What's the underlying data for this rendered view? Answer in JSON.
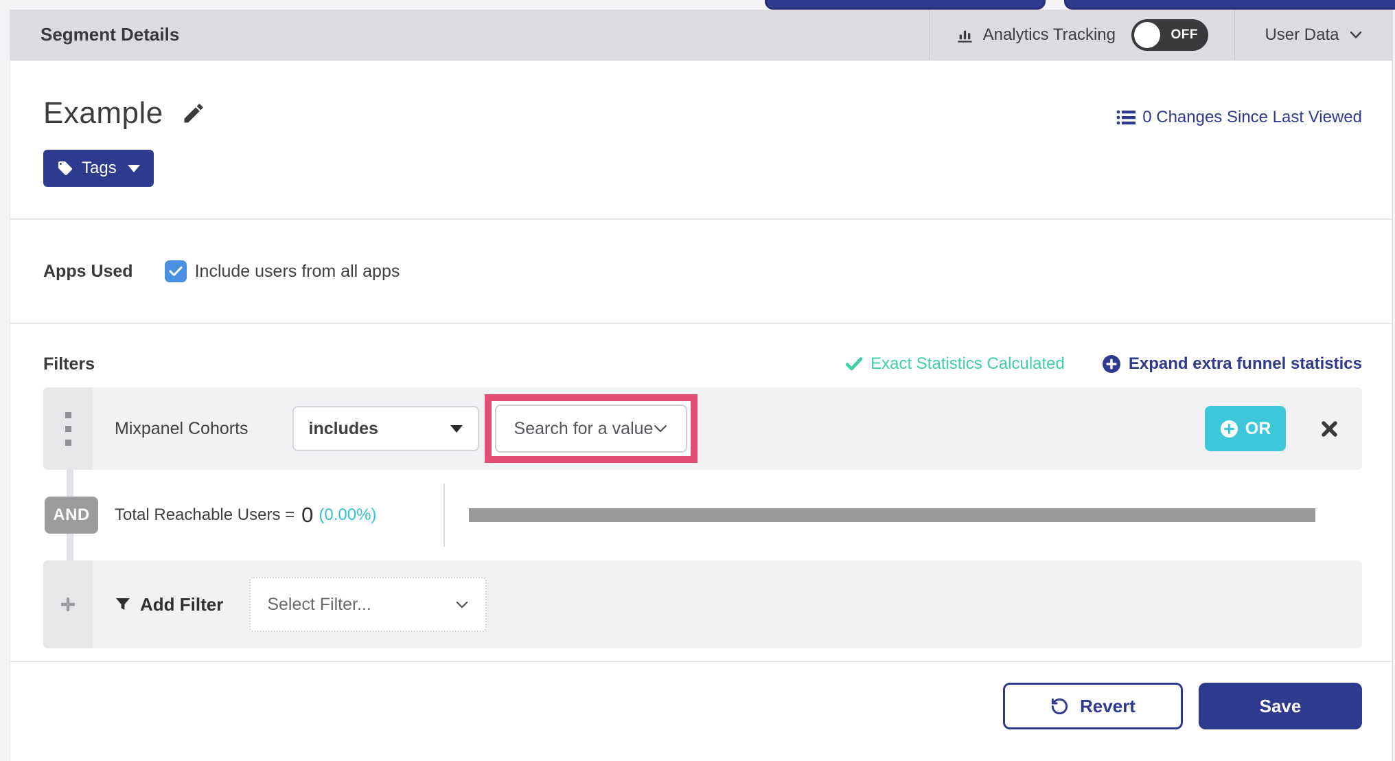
{
  "header": {
    "title": "Segment Details",
    "analytics_label": "Analytics Tracking",
    "toggle_state": "OFF",
    "user_data_label": "User Data"
  },
  "segment": {
    "name": "Example",
    "tags_label": "Tags",
    "changes_link": "0 Changes Since Last Viewed"
  },
  "apps": {
    "label": "Apps Used",
    "checkbox_label": "Include users from all apps",
    "checked": true
  },
  "filters": {
    "heading": "Filters",
    "exact_stats": "Exact Statistics Calculated",
    "expand_link": "Expand extra funnel statistics",
    "row": {
      "field": "Mixpanel Cohorts",
      "operator": "includes",
      "value_placeholder": "Search for a value",
      "or_label": "OR"
    },
    "and_label": "AND",
    "total": {
      "label": "Total Reachable Users =",
      "value": "0",
      "percent": "(0.00%)"
    },
    "add": {
      "label": "Add Filter",
      "placeholder": "Select Filter..."
    }
  },
  "footer": {
    "revert_label": "Revert",
    "save_label": "Save"
  },
  "colors": {
    "accent_indigo": "#2e3a8d",
    "teal_success": "#3ecfa8",
    "cyan_accent": "#35c2d6",
    "or_button_teal": "#3cc8da",
    "highlight_pink": "#e24e74",
    "checkbox_blue": "#4a90e2",
    "toggle_off_dark": "#3a3a3c"
  }
}
